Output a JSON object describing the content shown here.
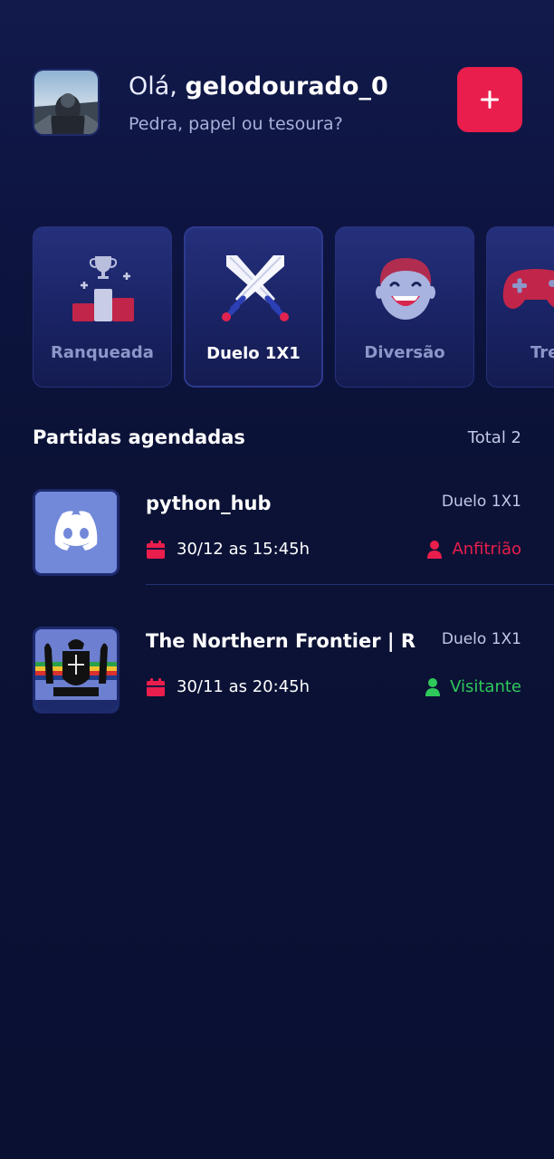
{
  "header": {
    "greeting": "Olá,",
    "username": "gelodourado_0",
    "subtitle": "Pedra, papel ou tesoura?",
    "add_icon": "plus-icon"
  },
  "categories": [
    {
      "label": "Ranqueada",
      "icon": "podium-trophy-icon",
      "active": false
    },
    {
      "label": "Duelo 1X1",
      "icon": "crossed-swords-icon",
      "active": true
    },
    {
      "label": "Diversão",
      "icon": "laughing-face-icon",
      "active": false
    },
    {
      "label": "Tre",
      "icon": "gamepad-icon",
      "active": false
    }
  ],
  "scheduled": {
    "title": "Partidas agendadas",
    "total_label": "Total 2",
    "matches": [
      {
        "name": "python_hub",
        "mode": "Duelo 1X1",
        "date": "30/12 as 15:45h",
        "role": "Anfitrião",
        "role_color": "#ea1e4c",
        "thumb_icon": "discord-icon"
      },
      {
        "name": "The Northern Frontier | R...",
        "mode": "Duelo 1X1",
        "date": "30/11 as 20:45h",
        "role": "Visitante",
        "role_color": "#2ec95a",
        "thumb_icon": "coat-of-arms-logo"
      }
    ]
  },
  "colors": {
    "background": "#0b1033",
    "accent": "#ea1e4c",
    "card": "#1f2a72",
    "visitor": "#2ec95a"
  }
}
